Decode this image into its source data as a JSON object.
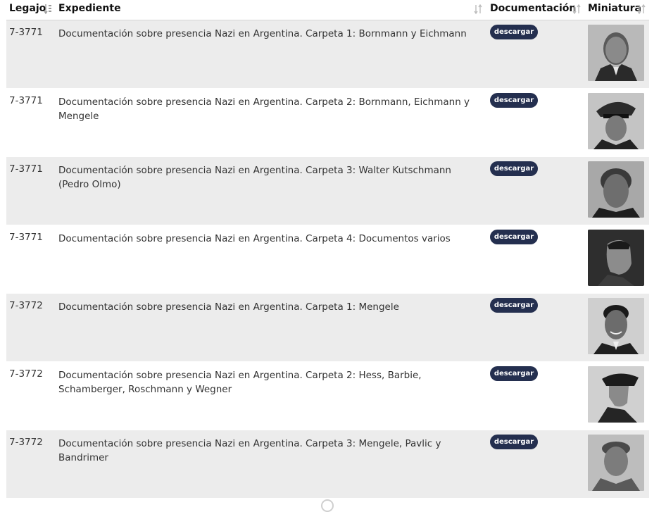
{
  "table": {
    "headers": {
      "legajo": "Legajo",
      "expediente": "Expediente",
      "documentacion": "Documentación",
      "miniatura": "Miniatura"
    },
    "rows": [
      {
        "legajo": "7-3771",
        "expediente": "Documentación sobre presencia Nazi en Argentina. Carpeta 1: Bornmann y Eichmann",
        "button": "descargar",
        "thumb": "portrait-bald-man-suit"
      },
      {
        "legajo": "7-3771",
        "expediente": "Documentación sobre presencia Nazi en Argentina. Carpeta 2: Bornmann, Eichmann y Mengele",
        "button": "descargar",
        "thumb": "portrait-uniform-cap"
      },
      {
        "legajo": "7-3771",
        "expediente": "Documentación sobre presencia Nazi en Argentina. Carpeta 3: Walter Kutschmann (Pedro Olmo)",
        "button": "descargar",
        "thumb": "portrait-older-man"
      },
      {
        "legajo": "7-3771",
        "expediente": "Documentación sobre presencia Nazi en Argentina. Carpeta 4: Documentos varios",
        "button": "descargar",
        "thumb": "portrait-profile-man"
      },
      {
        "legajo": "7-3772",
        "expediente": "Documentación sobre presencia Nazi en Argentina. Carpeta 1: Mengele",
        "button": "descargar",
        "thumb": "portrait-smiling-man"
      },
      {
        "legajo": "7-3772",
        "expediente": "Documentación sobre presencia Nazi en Argentina. Carpeta 2: Hess, Barbie, Schamberger, Roschmann y Wegner",
        "button": "descargar",
        "thumb": "portrait-officer-profile"
      },
      {
        "legajo": "7-3772",
        "expediente": "Documentación sobre presencia Nazi en Argentina. Carpeta 3: Mengele, Pavlic y Bandrimer",
        "button": "descargar",
        "thumb": "portrait-uniform-man"
      }
    ]
  },
  "colors": {
    "button_bg": "#242f4f",
    "row_alt_bg": "#ececec",
    "header_text": "#111111"
  },
  "icons": {
    "sort": "sort-arrows-icon"
  }
}
